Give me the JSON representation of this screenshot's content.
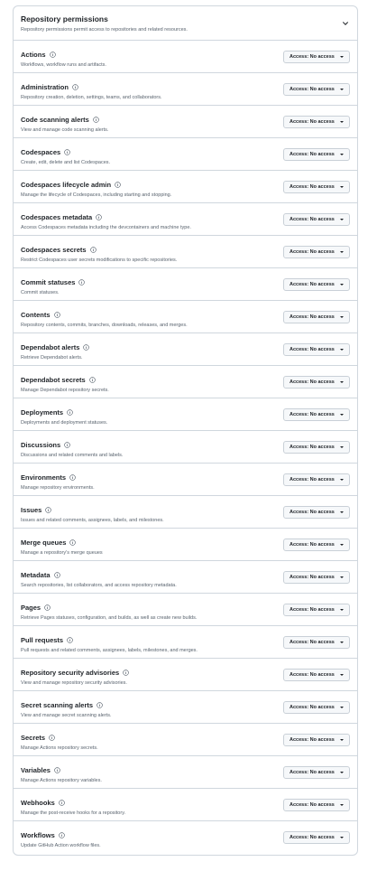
{
  "header": {
    "title": "Repository permissions",
    "description": "Repository permissions permit access to repositories and related resources."
  },
  "permissions": [
    {
      "name": "Actions",
      "description": "Workflows, workflow runs and artifacts.",
      "access": "Access: No access"
    },
    {
      "name": "Administration",
      "description": "Repository creation, deletion, settings, teams, and collaborators.",
      "access": "Access: No access"
    },
    {
      "name": "Code scanning alerts",
      "description": "View and manage code scanning alerts.",
      "access": "Access: No access"
    },
    {
      "name": "Codespaces",
      "description": "Create, edit, delete and list Codespaces.",
      "access": "Access: No access"
    },
    {
      "name": "Codespaces lifecycle admin",
      "description": "Manage the lifecycle of Codespaces, including starting and stopping.",
      "access": "Access: No access"
    },
    {
      "name": "Codespaces metadata",
      "description": "Access Codespaces metadata including the devcontainers and machine type.",
      "access": "Access: No access"
    },
    {
      "name": "Codespaces secrets",
      "description": "Restrict Codespaces user secrets modifications to specific repositories.",
      "access": "Access: No access"
    },
    {
      "name": "Commit statuses",
      "description": "Commit statuses.",
      "access": "Access: No access"
    },
    {
      "name": "Contents",
      "description": "Repository contents, commits, branches, downloads, releases, and merges.",
      "access": "Access: No access"
    },
    {
      "name": "Dependabot alerts",
      "description": "Retrieve Dependabot alerts.",
      "access": "Access: No access"
    },
    {
      "name": "Dependabot secrets",
      "description": "Manage Dependabot repository secrets.",
      "access": "Access: No access"
    },
    {
      "name": "Deployments",
      "description": "Deployments and deployment statuses.",
      "access": "Access: No access"
    },
    {
      "name": "Discussions",
      "description": "Discussions and related comments and labels.",
      "access": "Access: No access"
    },
    {
      "name": "Environments",
      "description": "Manage repository environments.",
      "access": "Access: No access"
    },
    {
      "name": "Issues",
      "description": "Issues and related comments, assignees, labels, and milestones.",
      "access": "Access: No access"
    },
    {
      "name": "Merge queues",
      "description": "Manage a repository's merge queues",
      "access": "Access: No access"
    },
    {
      "name": "Metadata",
      "description": "Search repositories, list collaborators, and access repository metadata.",
      "access": "Access: No access"
    },
    {
      "name": "Pages",
      "description": "Retrieve Pages statuses, configuration, and builds, as well as create new builds.",
      "access": "Access: No access"
    },
    {
      "name": "Pull requests",
      "description": "Pull requests and related comments, assignees, labels, milestones, and merges.",
      "access": "Access: No access"
    },
    {
      "name": "Repository security advisories",
      "description": "View and manage repository security advisories.",
      "access": "Access: No access"
    },
    {
      "name": "Secret scanning alerts",
      "description": "View and manage secret scanning alerts.",
      "access": "Access: No access"
    },
    {
      "name": "Secrets",
      "description": "Manage Actions repository secrets.",
      "access": "Access: No access"
    },
    {
      "name": "Variables",
      "description": "Manage Actions repository variables.",
      "access": "Access: No access"
    },
    {
      "name": "Webhooks",
      "description": "Manage the post-receive hooks for a repository.",
      "access": "Access: No access"
    },
    {
      "name": "Workflows",
      "description": "Update GitHub Action workflow files.",
      "access": "Access: No access"
    }
  ]
}
